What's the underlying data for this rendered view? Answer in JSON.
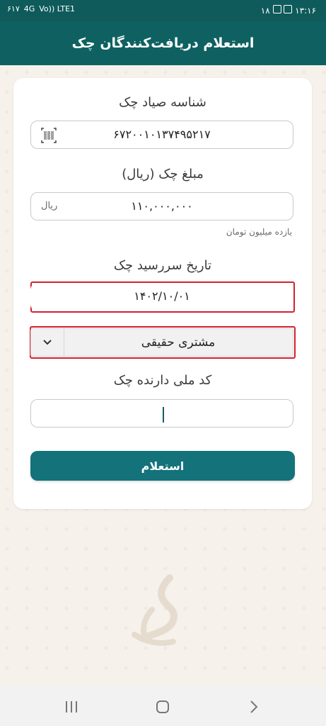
{
  "status_bar": {
    "time": "۱۳:۱۶",
    "battery": "۱۸",
    "signal_text": "۶۱۷",
    "network": "4G",
    "volte": "Vo)) LTE1"
  },
  "header": {
    "title": "استعلام دریافت‌کنندگان چک"
  },
  "form": {
    "sayad_label": "شناسه صیاد چک",
    "sayad_value": "۶۷۲۰۰۱۰۱۳۷۴۹۵۲۱۷",
    "amount_label": "مبلغ چک (ریال)",
    "amount_value": "۱۱۰,۰۰۰,۰۰۰",
    "amount_unit": "ریال",
    "amount_words": "یازده میلیون تومان",
    "date_label": "تاریخ سررسید چک",
    "date_value": "۱۴۰۲/۱۰/۰۱",
    "customer_type_selected": "مشتری حقیقی",
    "national_id_label": "کد ملی دارنده چک",
    "national_id_value": "",
    "submit_label": "استعلام"
  },
  "navbar": {
    "recent_icon": "recent-apps-icon",
    "home_icon": "home-icon",
    "back_icon": "back-icon"
  },
  "colors": {
    "primary": "#0f6161",
    "button": "#13727a",
    "highlight": "#d3202f"
  }
}
